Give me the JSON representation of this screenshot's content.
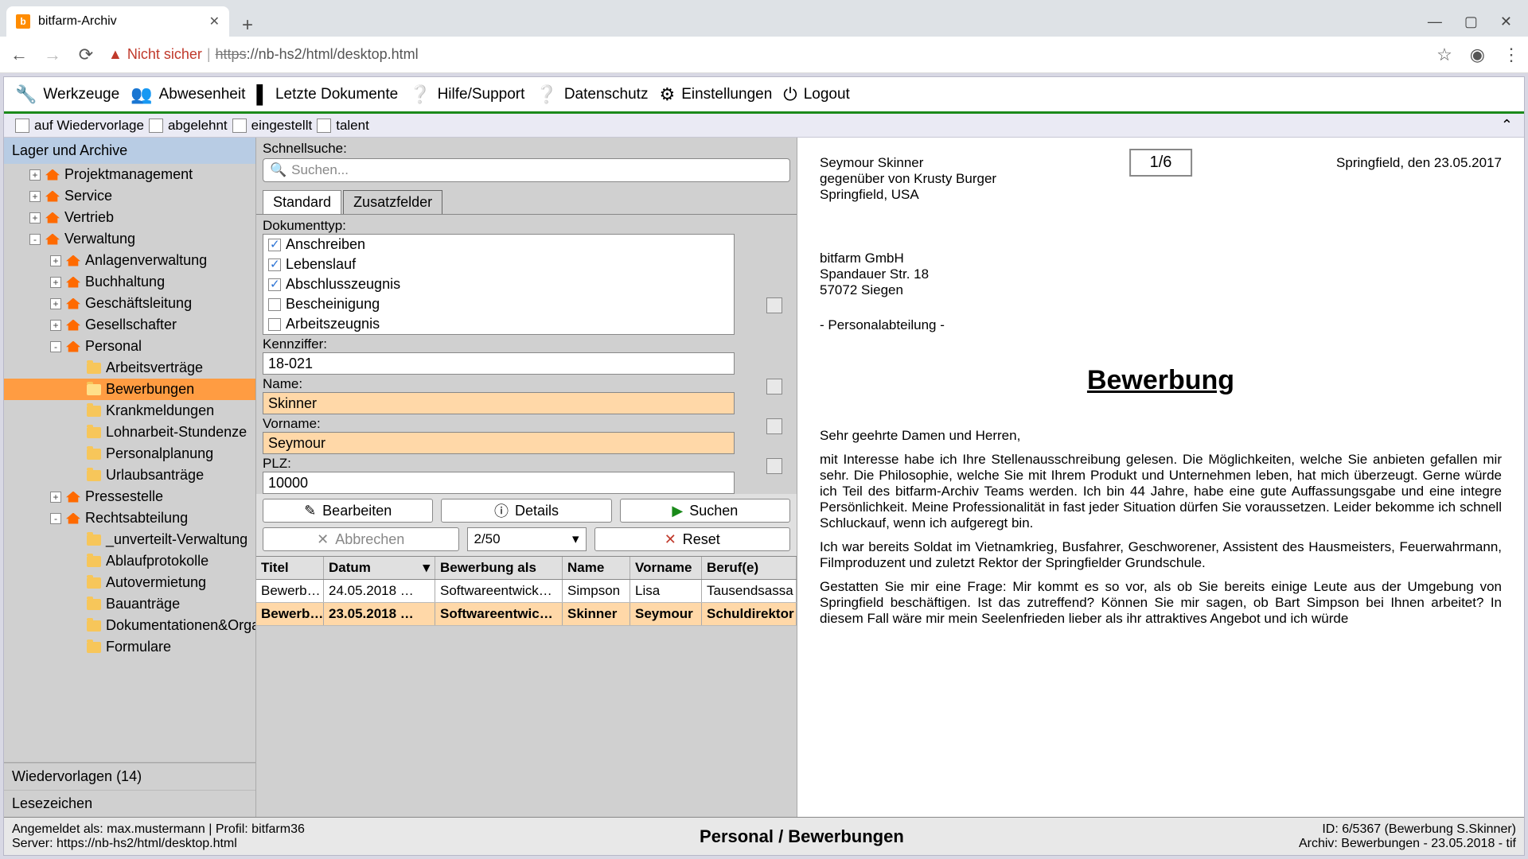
{
  "browser": {
    "tab_title": "bitfarm-Archiv",
    "url_label": "Nicht sicher",
    "url_prefix": "https",
    "url_rest": "://nb-hs2/html/desktop.html"
  },
  "toolbar": {
    "werkzeuge": "Werkzeuge",
    "abwesenheit": "Abwesenheit",
    "letzte": "Letzte Dokumente",
    "hilfe": "Hilfe/Support",
    "datenschutz": "Datenschutz",
    "einstellungen": "Einstellungen",
    "logout": "Logout"
  },
  "tags": {
    "wiedervorlage": "auf Wiedervorlage",
    "abgelehnt": "abgelehnt",
    "eingestellt": "eingestellt",
    "talent": "talent"
  },
  "tree": {
    "header": "Lager und Archive",
    "items": [
      {
        "exp": "+",
        "d": 1,
        "icon": "house",
        "label": "Projektmanagement"
      },
      {
        "exp": "+",
        "d": 1,
        "icon": "house",
        "label": "Service"
      },
      {
        "exp": "+",
        "d": 1,
        "icon": "house",
        "label": "Vertrieb"
      },
      {
        "exp": "-",
        "d": 1,
        "icon": "house",
        "label": "Verwaltung"
      },
      {
        "exp": "+",
        "d": 2,
        "icon": "house",
        "label": "Anlagenverwaltung"
      },
      {
        "exp": "+",
        "d": 2,
        "icon": "house",
        "label": "Buchhaltung"
      },
      {
        "exp": "+",
        "d": 2,
        "icon": "house",
        "label": "Geschäftsleitung"
      },
      {
        "exp": "+",
        "d": 2,
        "icon": "house",
        "label": "Gesellschafter"
      },
      {
        "exp": "-",
        "d": 2,
        "icon": "house",
        "label": "Personal"
      },
      {
        "exp": "",
        "d": 3,
        "icon": "folder",
        "label": "Arbeitsverträge"
      },
      {
        "exp": "",
        "d": 3,
        "icon": "folder-open",
        "label": "Bewerbungen",
        "sel": true
      },
      {
        "exp": "",
        "d": 3,
        "icon": "folder",
        "label": "Krankmeldungen"
      },
      {
        "exp": "",
        "d": 3,
        "icon": "folder",
        "label": "Lohnarbeit-Stundenze"
      },
      {
        "exp": "",
        "d": 3,
        "icon": "folder",
        "label": "Personalplanung"
      },
      {
        "exp": "",
        "d": 3,
        "icon": "folder",
        "label": "Urlaubsanträge"
      },
      {
        "exp": "+",
        "d": 2,
        "icon": "house",
        "label": "Pressestelle"
      },
      {
        "exp": "-",
        "d": 2,
        "icon": "house",
        "label": "Rechtsabteilung"
      },
      {
        "exp": "",
        "d": 3,
        "icon": "folder",
        "label": "_unverteilt-Verwaltung"
      },
      {
        "exp": "",
        "d": 3,
        "icon": "folder",
        "label": "Ablaufprotokolle"
      },
      {
        "exp": "",
        "d": 3,
        "icon": "folder",
        "label": "Autovermietung"
      },
      {
        "exp": "",
        "d": 3,
        "icon": "folder",
        "label": "Bauanträge"
      },
      {
        "exp": "",
        "d": 3,
        "icon": "folder",
        "label": "Dokumentationen&Orga"
      },
      {
        "exp": "",
        "d": 3,
        "icon": "folder",
        "label": "Formulare"
      }
    ],
    "wiedervorlagen": "Wiedervorlagen (14)",
    "lesezeichen": "Lesezeichen"
  },
  "search": {
    "quick_label": "Schnellsuche:",
    "quick_placeholder": "Suchen...",
    "tab_standard": "Standard",
    "tab_zusatz": "Zusatzfelder",
    "doktyp_label": "Dokumenttyp:",
    "doktyp_options": [
      {
        "label": "Anschreiben",
        "on": true
      },
      {
        "label": "Lebenslauf",
        "on": true
      },
      {
        "label": "Abschlusszeugnis",
        "on": true
      },
      {
        "label": "Bescheinigung",
        "on": false
      },
      {
        "label": "Arbeitszeugnis",
        "on": false
      }
    ],
    "kennziffer_label": "Kennziffer:",
    "kennziffer_value": "18-021",
    "name_label": "Name:",
    "name_value": "Skinner",
    "vorname_label": "Vorname:",
    "vorname_value": "Seymour",
    "plz_label": "PLZ:",
    "plz_value": "10000",
    "btn_bearbeiten": "Bearbeiten",
    "btn_details": "Details",
    "btn_suchen": "Suchen",
    "btn_abbrechen": "Abbrechen",
    "limit": "2/50",
    "btn_reset": "Reset"
  },
  "results": {
    "cols": {
      "titel": "Titel",
      "datum": "Datum",
      "als": "Bewerbung als",
      "name": "Name",
      "vorname": "Vorname",
      "beruf": "Beruf(e)"
    },
    "rows": [
      {
        "titel": "Bewerb…",
        "datum": "24.05.2018 …",
        "als": "Softwareentwick…",
        "name": "Simpson",
        "vorname": "Lisa",
        "beruf": "Tausendsassa"
      },
      {
        "titel": "Bewerb…",
        "datum": "23.05.2018 …",
        "als": "Softwareentwic…",
        "name": "Skinner",
        "vorname": "Seymour",
        "beruf": "Schuldirektor",
        "sel": true
      }
    ]
  },
  "preview": {
    "page": "1/6",
    "sender1": "Seymour Skinner",
    "sender2": "gegenüber von Krusty Burger",
    "sender3": "Springfield, USA",
    "dateline": "Springfield, den 23.05.2017",
    "addr1": "bitfarm GmbH",
    "addr2": "Spandauer Str. 18",
    "addr3": "57072 Siegen",
    "dept": "- Personalabteilung -",
    "title": "Bewerbung",
    "greet": "Sehr geehrte Damen und Herren,",
    "p1": "mit Interesse habe ich Ihre Stellenausschreibung gelesen. Die Möglichkeiten, welche Sie anbieten gefallen mir sehr. Die Philosophie, welche Sie mit Ihrem Produkt und Unternehmen leben, hat mich überzeugt. Gerne würde ich Teil des bitfarm-Archiv Teams werden. Ich bin 44 Jahre, habe eine gute Auffassungsgabe und eine integre Persönlichkeit. Meine Professionalität in fast jeder Situation dürfen Sie voraussetzen. Leider bekomme ich schnell Schluckauf, wenn ich aufgeregt bin.",
    "p2": "Ich war bereits Soldat im Vietnamkrieg, Busfahrer, Geschworener, Assistent des Hausmeisters, Feuerwahrmann, Filmproduzent und zuletzt Rektor der Springfielder Grundschule.",
    "p3": "Gestatten Sie mir eine Frage: Mir kommt es so vor, als ob Sie bereits einige Leute aus der Umgebung von Springfield beschäftigen. Ist das zutreffend? Können Sie mir sagen, ob Bart Simpson bei Ihnen arbeitet? In diesem Fall wäre mir mein Seelenfrieden lieber als ihr attraktives Angebot und ich würde"
  },
  "status": {
    "login": "Angemeldet als: max.mustermann | Profil: bitfarm36",
    "server": "Server: https://nb-hs2/html/desktop.html",
    "mid": "Personal / Bewerbungen",
    "id": "ID: 6/5367 (Bewerbung S.Skinner)",
    "archiv": "Archiv: Bewerbungen - 23.05.2018 - tif"
  }
}
